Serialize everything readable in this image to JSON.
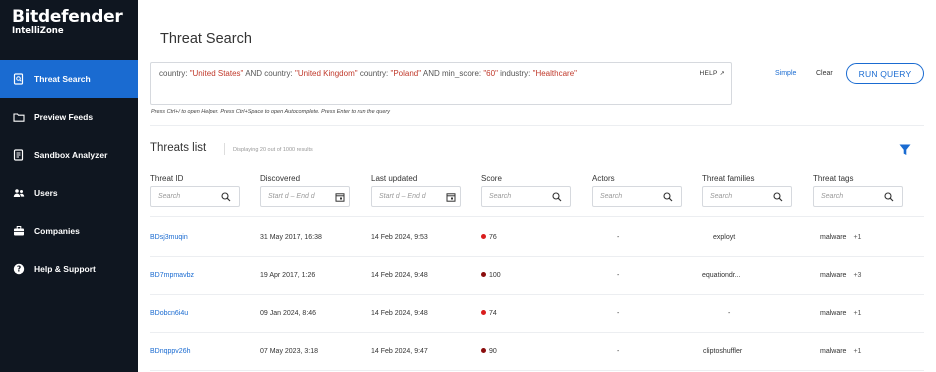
{
  "brand": {
    "name": "Bitdefender",
    "sub": "IntelliZone"
  },
  "nav": [
    {
      "label": "Threat Search",
      "icon": "search-doc-icon",
      "active": true
    },
    {
      "label": "Preview Feeds",
      "icon": "folder-icon",
      "active": false
    },
    {
      "label": "Sandbox Analyzer",
      "icon": "sandbox-icon",
      "active": false
    },
    {
      "label": "Users",
      "icon": "users-icon",
      "active": false
    },
    {
      "label": "Companies",
      "icon": "briefcase-icon",
      "active": false
    },
    {
      "label": "Help & Support",
      "icon": "help-icon",
      "active": false
    }
  ],
  "page": {
    "title": "Threat Search"
  },
  "query": {
    "t1": "country: ",
    "v1": "\"United States\"",
    "t2": " AND country: ",
    "v2": "\"United Kingdom\"",
    "t3": "  country: ",
    "v3": "\"Poland\"",
    "t4": "  AND min_score: ",
    "v4": "\"60\"",
    "t5": "  industry: ",
    "v5": "\"Healthcare\"",
    "help": "HELP",
    "hint": "Press Ctrl+/ to open Helper. Press Ctrl+Space to open Autocomplete. Press Enter to run the query"
  },
  "actions": {
    "simple": "Simple",
    "clear": "Clear",
    "run": "RUN QUERY"
  },
  "list": {
    "title": "Threats list",
    "count": "Displaying 20 out of 1000 results"
  },
  "columns": [
    {
      "label": "Threat ID",
      "placeholder": "Search"
    },
    {
      "label": "Discovered",
      "placeholder": "Start d – End d"
    },
    {
      "label": "Last updated",
      "placeholder": "Start d – End d"
    },
    {
      "label": "Score",
      "placeholder": "Search"
    },
    {
      "label": "Actors",
      "placeholder": "Search"
    },
    {
      "label": "Threat families",
      "placeholder": "Search"
    },
    {
      "label": "Threat tags",
      "placeholder": "Search"
    }
  ],
  "rows": [
    {
      "id": "BDsj3muqin",
      "discovered": "31 May 2017, 16:38",
      "updated": "14 Feb 2024, 9:53",
      "score": "76",
      "score_color": "#d91c1c",
      "actors": "-",
      "family": "exployt",
      "tag": "malware",
      "more": "+1"
    },
    {
      "id": "BD7mpmavbz",
      "discovered": "19 Apr 2017, 1:26",
      "updated": "14 Feb 2024, 9:48",
      "score": "100",
      "score_color": "#8b0d0d",
      "actors": "-",
      "family": "equationdr...",
      "tag": "malware",
      "more": "+3"
    },
    {
      "id": "BDobcn6i4u",
      "discovered": "09 Jan 2024, 8:46",
      "updated": "14 Feb 2024, 9:48",
      "score": "74",
      "score_color": "#d91c1c",
      "actors": "-",
      "family": "-",
      "tag": "malware",
      "more": "+1"
    },
    {
      "id": "BDnqppv26h",
      "discovered": "07 May 2023, 3:18",
      "updated": "14 Feb 2024, 9:47",
      "score": "90",
      "score_color": "#8b0d0d",
      "actors": "-",
      "family": "cliptoshuffler",
      "tag": "malware",
      "more": "+1"
    }
  ],
  "colors": {
    "sidebar_bg": "#0f1620",
    "accent": "#1a6bd1",
    "query_value": "#c0392b"
  }
}
